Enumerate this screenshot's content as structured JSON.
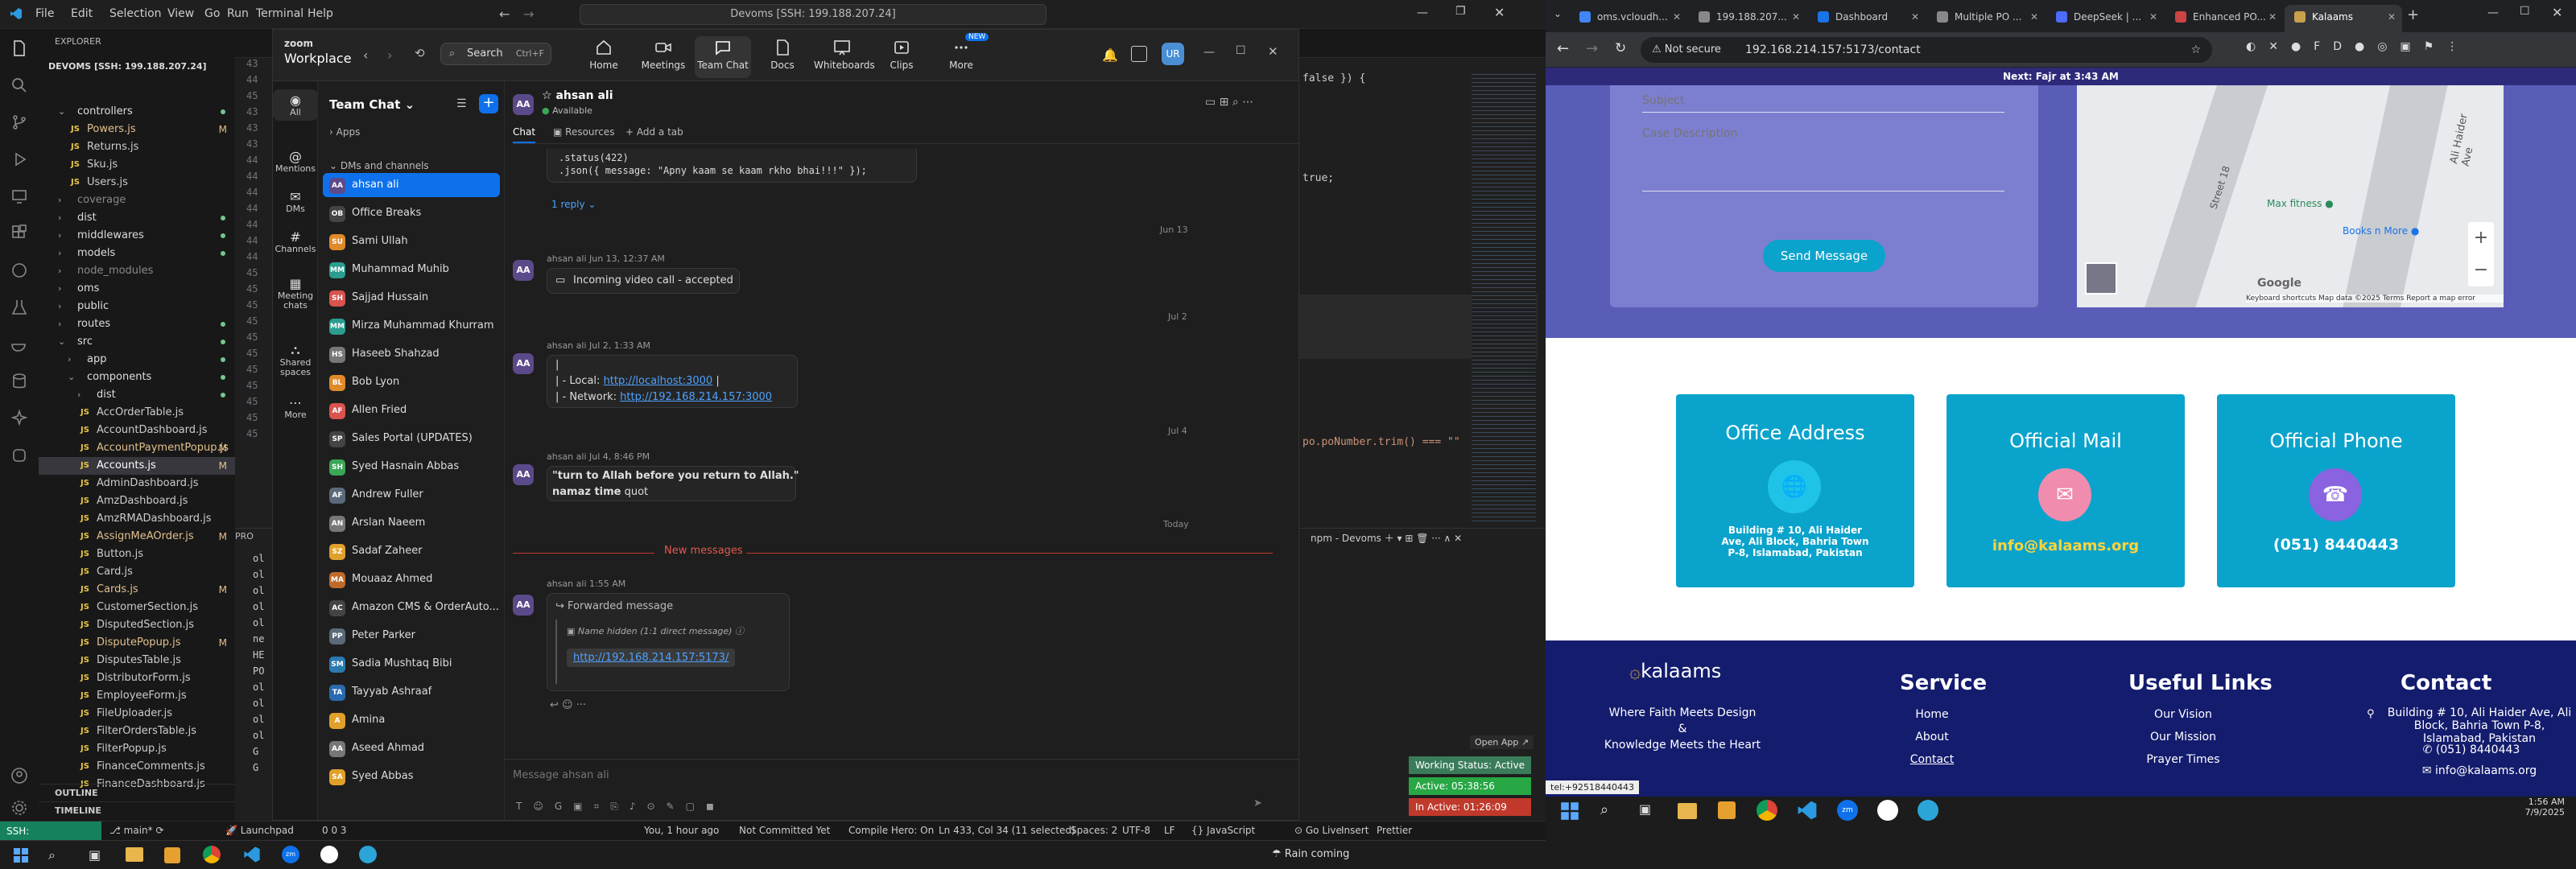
{
  "vscode": {
    "title": "Devoms [SSH: 199.188.207.24]",
    "menu": [
      "File",
      "Edit",
      "Selection",
      "View",
      "Go",
      "Run",
      "Terminal",
      "Help"
    ],
    "explorer_label": "EXPLORER",
    "root": "DEVOMS [SSH: 199.188.207.24]",
    "tree": [
      {
        "t": "controllers",
        "folder": true,
        "indent": 1,
        "open": true,
        "color": "#ddd",
        "dot": true
      },
      {
        "t": "Powers.js",
        "js": true,
        "indent": 2,
        "color": "#e2c08d",
        "mark": "M"
      },
      {
        "t": "Returns.js",
        "js": true,
        "indent": 2,
        "color": "#ccc"
      },
      {
        "t": "Sku.js",
        "js": true,
        "indent": 2,
        "color": "#ccc"
      },
      {
        "t": "Users.js",
        "js": true,
        "indent": 2,
        "color": "#ccc"
      },
      {
        "t": "coverage",
        "folder": true,
        "indent": 1,
        "color": "#888"
      },
      {
        "t": "dist",
        "folder": true,
        "indent": 1,
        "color": "#ddd",
        "dot": true
      },
      {
        "t": "middlewares",
        "folder": true,
        "indent": 1,
        "color": "#ddd",
        "dot": true
      },
      {
        "t": "models",
        "folder": true,
        "indent": 1,
        "color": "#ddd",
        "dot": true
      },
      {
        "t": "node_modules",
        "folder": true,
        "indent": 1,
        "color": "#888"
      },
      {
        "t": "oms",
        "folder": true,
        "indent": 1,
        "color": "#ddd"
      },
      {
        "t": "public",
        "folder": true,
        "indent": 1,
        "color": "#ddd"
      },
      {
        "t": "routes",
        "folder": true,
        "indent": 1,
        "color": "#ddd",
        "dot": true
      },
      {
        "t": "src",
        "folder": true,
        "indent": 1,
        "open": true,
        "color": "#ddd",
        "dot": true
      },
      {
        "t": "app",
        "folder": true,
        "indent": 2,
        "color": "#ddd",
        "dot": true
      },
      {
        "t": "components",
        "folder": true,
        "indent": 2,
        "open": true,
        "color": "#ddd",
        "dot": true
      },
      {
        "t": "dist",
        "folder": true,
        "indent": 3,
        "color": "#ddd",
        "dot": true
      },
      {
        "t": "AccOrderTable.js",
        "js": true,
        "indent": 3,
        "color": "#ccc"
      },
      {
        "t": "AccountDashboard.js",
        "js": true,
        "indent": 3,
        "color": "#ccc"
      },
      {
        "t": "AccountPaymentPopup.js",
        "js": true,
        "indent": 3,
        "color": "#e2c08d",
        "mark": "M"
      },
      {
        "t": "Accounts.js",
        "js": true,
        "indent": 3,
        "color": "#fff",
        "mark": "M",
        "sel": true
      },
      {
        "t": "AdminDashboard.js",
        "js": true,
        "indent": 3,
        "color": "#ccc"
      },
      {
        "t": "AmzDashboard.js",
        "js": true,
        "indent": 3,
        "color": "#ccc"
      },
      {
        "t": "AmzRMADashboard.js",
        "js": true,
        "indent": 3,
        "color": "#ccc"
      },
      {
        "t": "AssignMeAOrder.js",
        "js": true,
        "indent": 3,
        "color": "#e2c08d",
        "mark": "M"
      },
      {
        "t": "Button.js",
        "js": true,
        "indent": 3,
        "color": "#ccc"
      },
      {
        "t": "Card.js",
        "js": true,
        "indent": 3,
        "color": "#ccc"
      },
      {
        "t": "Cards.js",
        "js": true,
        "indent": 3,
        "color": "#e2c08d",
        "mark": "M"
      },
      {
        "t": "CustomerSection.js",
        "js": true,
        "indent": 3,
        "color": "#ccc"
      },
      {
        "t": "DisputedSection.js",
        "js": true,
        "indent": 3,
        "color": "#ccc"
      },
      {
        "t": "DisputePopup.js",
        "js": true,
        "indent": 3,
        "color": "#e2c08d",
        "mark": "M"
      },
      {
        "t": "DisputesTable.js",
        "js": true,
        "indent": 3,
        "color": "#ccc"
      },
      {
        "t": "DistributorForm.js",
        "js": true,
        "indent": 3,
        "color": "#ccc"
      },
      {
        "t": "EmployeeForm.js",
        "js": true,
        "indent": 3,
        "color": "#ccc"
      },
      {
        "t": "FileUploader.js",
        "js": true,
        "indent": 3,
        "color": "#ccc"
      },
      {
        "t": "FilterOrdersTable.js",
        "js": true,
        "indent": 3,
        "color": "#ccc"
      },
      {
        "t": "FilterPopup.js",
        "js": true,
        "indent": 3,
        "color": "#ccc"
      },
      {
        "t": "FinanceComments.js",
        "js": true,
        "indent": 3,
        "color": "#ccc"
      },
      {
        "t": "FinanceDashboard.js",
        "js": true,
        "indent": 3,
        "color": "#ccc"
      }
    ],
    "outline": "OUTLINE",
    "timeline": "TIMELINE",
    "code_right": [
      {
        "t": "false }) {"
      },
      {
        "t": "true;"
      },
      {
        "t": "po.poNumber.trim() === \"\""
      }
    ],
    "gutter": [
      "43",
      "44",
      "45",
      "43",
      "43",
      "43",
      "44",
      "44",
      "44",
      "44",
      "44",
      "44",
      "44",
      "45",
      "45",
      "45",
      "45",
      "45",
      "45",
      "45",
      "45",
      "45",
      "45",
      "45"
    ],
    "terminal_title": "npm - Devoms",
    "terminal_lines": [
      "ol",
      "ol",
      "ol",
      "ol",
      "ol",
      "ne",
      "HE",
      "PO",
      "ol",
      "ol",
      "ol",
      "ol",
      "G",
      "G"
    ],
    "status": {
      "remote": "SSH: 199.188.207.24",
      "branch": "main*",
      "launchpad": "Launchpad",
      "problems": "0  0  3",
      "blame": "You, 1 hour ago",
      "commit": "Not Committed Yet",
      "compile": "Compile Hero: On",
      "pos": "Ln 433, Col 34 (11 selected)",
      "spaces": "Spaces: 2",
      "enc": "UTF-8",
      "eol": "LF",
      "lang": "JavaScript",
      "golive": "Go Live",
      "insert": "Insert",
      "prettier": "Prettier",
      "prettier2": "Prettier"
    }
  },
  "zoom": {
    "brand_top": "zoom",
    "brand_bottom": "Workplace",
    "search": "Search",
    "search_kbd": "Ctrl+F",
    "tabs": [
      {
        "label": "Home",
        "icon": "home-icon"
      },
      {
        "label": "Meetings",
        "icon": "camera-icon"
      },
      {
        "label": "Team Chat",
        "icon": "chat-icon",
        "on": true
      },
      {
        "label": "Docs",
        "icon": "docs-icon"
      },
      {
        "label": "Whiteboards",
        "icon": "whiteboard-icon"
      },
      {
        "label": "Clips",
        "icon": "clips-icon"
      },
      {
        "label": "More",
        "icon": "more-icon",
        "badge": "NEW"
      }
    ],
    "rail": [
      "All",
      "Mentions",
      "DMs",
      "Channels",
      "Meeting chats",
      "Shared spaces",
      "More"
    ],
    "list_title": "Team Chat",
    "apps": "Apps",
    "dms_header": "DMs and channels",
    "contacts": [
      {
        "n": "ahsan ali",
        "i": "AA",
        "c": "#5b4a8a",
        "sel": true
      },
      {
        "n": "Office Breaks",
        "i": "OB",
        "c": "#444"
      },
      {
        "n": "Sami Ullah",
        "i": "SU",
        "c": "#e08a2a"
      },
      {
        "n": "Muhammad Muhib",
        "i": "MM",
        "c": "#2a9d8f"
      },
      {
        "n": "Sajjad Hussain",
        "i": "SH",
        "c": "#d9534f"
      },
      {
        "n": "Mirza Muhammad Khurram",
        "i": "MM",
        "c": "#2a9d8f"
      },
      {
        "n": "Haseeb Shahzad",
        "i": "HS",
        "c": "#777"
      },
      {
        "n": "Bob Lyon",
        "i": "BL",
        "c": "#e08a2a"
      },
      {
        "n": "Allen Fried",
        "i": "AF",
        "c": "#d9534f"
      },
      {
        "n": "Sales Portal (UPDATES)",
        "i": "SP",
        "c": "#444"
      },
      {
        "n": "Syed Hasnain Abbas",
        "i": "SH",
        "c": "#3aa757"
      },
      {
        "n": "Andrew Fuller",
        "i": "AF",
        "c": "#5a6a7a"
      },
      {
        "n": "Arslan Naeem",
        "i": "AN",
        "c": "#777"
      },
      {
        "n": "Sadaf Zaheer",
        "i": "SZ",
        "c": "#e0a02a"
      },
      {
        "n": "Mouaaz Ahmed",
        "i": "MA",
        "c": "#c06a2a"
      },
      {
        "n": "Amazon CMS & OrderAuto...",
        "i": "AC",
        "c": "#444"
      },
      {
        "n": "Peter Parker",
        "i": "PP",
        "c": "#5a6a7a"
      },
      {
        "n": "Sadia Mushtaq Bibi",
        "i": "SM",
        "c": "#2a7ab0"
      },
      {
        "n": "Tayyab Ashraaf",
        "i": "TA",
        "c": "#2a6ab0"
      },
      {
        "n": "Amina",
        "i": "A",
        "c": "#e0a02a"
      },
      {
        "n": "Aseed Ahmad",
        "i": "AA",
        "c": "#777"
      },
      {
        "n": "Syed Abbas",
        "i": "SA",
        "c": "#e0a02a"
      }
    ],
    "chat_name": "ahsan ali",
    "chat_status": "Available",
    "chat_tabs": [
      "Chat",
      "Resources",
      "Add a tab"
    ],
    "code_lines": [
      ".status(422)",
      ".json({ message: \"Apny kaam se kaam rkho bhai!!!\" });"
    ],
    "reply": "1 reply",
    "dates": [
      "Jun 13",
      "Jul 2",
      "Jul 4",
      "Today"
    ],
    "msg1_meta": "ahsan ali Jun 13, 12:37 AM",
    "msg1_text": "Incoming video call - accepted",
    "msg2_meta": "ahsan ali Jul 2, 1:33 AM",
    "msg2_local_label": "|   - Local:",
    "msg2_local": "http://localhost:3000",
    "msg2_net_label": "|   - Network:",
    "msg2_net": "http://192.168.214.157:3000",
    "msg3_meta": "ahsan ali Jul 4, 8:46 PM",
    "msg3_line1": "\"turn to Allah before you return to Allah.\"",
    "msg3_bold": "namaz time",
    "msg3_rest": " quot",
    "new_messages": "New messages",
    "msg4_meta": "ahsan ali 1:55 AM",
    "fwd_label": "Forwarded message",
    "fwd_hidden": "Name hidden (1:1 direct message)",
    "fwd_link": "http://192.168.214.157:5173/",
    "input_placeholder": "Message ahsan ali",
    "open_app": "Open App"
  },
  "badges": {
    "working": "Working Status: Active",
    "active": "Active: 05:38:56",
    "inactive": "In Active: 01:26:09"
  },
  "chrome": {
    "tabs": [
      {
        "t": "oms.vcloudh...",
        "c": "#4285f4"
      },
      {
        "t": "199.188.207...",
        "c": "#888"
      },
      {
        "t": "Dashboard",
        "c": "#1a73e8"
      },
      {
        "t": "Multiple PO ...",
        "c": "#888"
      },
      {
        "t": "DeepSeek | ...",
        "c": "#4d6bfe"
      },
      {
        "t": "Enhanced PO...",
        "c": "#c44"
      },
      {
        "t": "Kalaams",
        "c": "#c8a24a",
        "on": true
      }
    ],
    "not_secure": "Not secure",
    "url": "192.168.214.157:5173/contact",
    "prayer": "Next: Fajr at 3:43 AM",
    "subject": "Subject",
    "case_desc": "Case Description",
    "send": "Send Message",
    "map_labels": [
      "Street 18",
      "Ali Haider Ave",
      "Max fitness",
      "Books n More",
      "Google",
      "Keyboard shortcuts",
      "Map data ©2025",
      "Terms",
      "Report a map error"
    ],
    "cards": [
      {
        "h": "Office Address",
        "v": "Building # 10, Ali Haider Ave, Ali Block, Bahria Town P-8, Islamabad, Pakistan",
        "ic": "globe-icon"
      },
      {
        "h": "Official Mail",
        "v": "info@kalaams.org",
        "ic": "mail-icon"
      },
      {
        "h": "Official Phone",
        "v": "(051) 8440443",
        "ic": "phone-icon"
      }
    ],
    "footer": {
      "logo": "kalaams",
      "tag1": "Where Faith Meets Design",
      "tag2": "&",
      "tag3": "Knowledge Meets the Heart",
      "service_h": "Service",
      "service": [
        "Home",
        "About",
        "Contact"
      ],
      "links_h": "Useful Links",
      "links": [
        "Our Vision",
        "Our Mission",
        "Prayer Times"
      ],
      "contact_h": "Contact",
      "addr": "Building # 10, Ali Haider Ave, Ali Block, Bahria Town P-8, Islamabad, Pakistan",
      "phone": "(051) 8440443",
      "mail": "info@kalaams.org"
    },
    "status_tip": "tel:+92518440443"
  },
  "system": {
    "time": "1:56 AM",
    "date": "7/9/2025",
    "weather": "Rain coming"
  },
  "colors": {
    "zoom_blue": "#0e71eb",
    "vscode_green": "#16825d",
    "card": "#0aa3cc",
    "footer": "#141c6e",
    "form": "#5a5db8",
    "new_msg": "#d9534f"
  }
}
